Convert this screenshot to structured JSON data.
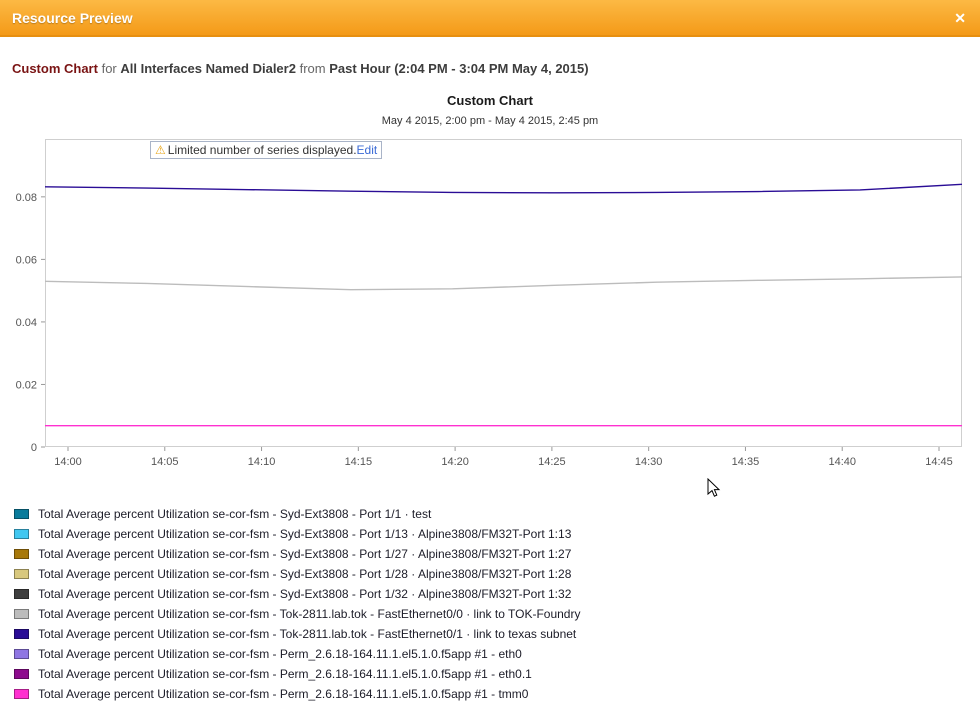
{
  "window": {
    "title": "Resource Preview",
    "close_label": "✕",
    "accent_color": "#f49a18"
  },
  "description": {
    "chart_name": "Custom Chart",
    "for_word": "for",
    "scope": "All Interfaces Named Dialer2",
    "from_word": "from",
    "range": "Past Hour (2:04 PM - 3:04 PM May 4, 2015)"
  },
  "chart_data": {
    "type": "line",
    "title": "Custom Chart",
    "subtitle": "May 4 2015, 2:00 pm - May 4 2015, 2:45 pm",
    "warning": {
      "icon": "⚠",
      "text": "Limited number of series displayed.",
      "link": "Edit"
    },
    "x_ticks": [
      "14:00",
      "14:05",
      "14:10",
      "14:15",
      "14:20",
      "14:25",
      "14:30",
      "14:35",
      "14:40",
      "14:45"
    ],
    "y_ticks": [
      "0",
      "0.02",
      "0.04",
      "0.06",
      "0.08"
    ],
    "ylim": [
      0,
      0.0985
    ],
    "grid": false,
    "legend_position": "bottom",
    "series": [
      {
        "name": "Total Average percent Utilization se-cor-fsm - Tok-2811.lab.tok - FastEthernet0/1 · link to texas subnet",
        "color": "#2a0d96",
        "values": [
          0.0832,
          0.0828,
          0.0823,
          0.0818,
          0.0814,
          0.0813,
          0.0814,
          0.0817,
          0.0822,
          0.084
        ]
      },
      {
        "name": "Total Average percent Utilization se-cor-fsm - Tok-2811.lab.tok - FastEthernet0/0 · link to TOK-Foundry",
        "color": "#bcbcbc",
        "values": [
          0.053,
          0.0523,
          0.0513,
          0.0503,
          0.0506,
          0.0517,
          0.0527,
          0.0533,
          0.0538,
          0.0544
        ]
      },
      {
        "name": "Total Average percent Utilization se-cor-fsm - Perm_2.6.18-164.11.1.el5.1.0.f5app #1 - tmm0",
        "color": "#ff30d0",
        "values": [
          0.0068,
          0.0068,
          0.0068,
          0.0068,
          0.0068,
          0.0068,
          0.0068,
          0.0068,
          0.0068,
          0.0068
        ]
      }
    ],
    "legend": [
      {
        "color": "#0a7c9c",
        "label": "Total Average percent Utilization se-cor-fsm - Syd-Ext3808 - Port 1/1 · test"
      },
      {
        "color": "#41c7f0",
        "label": "Total Average percent Utilization se-cor-fsm - Syd-Ext3808 - Port 1/13 · Alpine3808/FM32T-Port 1:13"
      },
      {
        "color": "#a8790b",
        "label": "Total Average percent Utilization se-cor-fsm - Syd-Ext3808 - Port 1/27 · Alpine3808/FM32T-Port 1:27"
      },
      {
        "color": "#d8c87e",
        "label": "Total Average percent Utilization se-cor-fsm - Syd-Ext3808 - Port 1/28 · Alpine3808/FM32T-Port 1:28"
      },
      {
        "color": "#3f3f3f",
        "label": "Total Average percent Utilization se-cor-fsm - Syd-Ext3808 - Port 1/32 · Alpine3808/FM32T-Port 1:32"
      },
      {
        "color": "#bcbcbc",
        "label": "Total Average percent Utilization se-cor-fsm - Tok-2811.lab.tok - FastEthernet0/0 · link to TOK-Foundry"
      },
      {
        "color": "#2a0d96",
        "label": "Total Average percent Utilization se-cor-fsm - Tok-2811.lab.tok - FastEthernet0/1 · link to texas subnet"
      },
      {
        "color": "#8f76e3",
        "label": "Total Average percent Utilization se-cor-fsm - Perm_2.6.18-164.11.1.el5.1.0.f5app #1 - eth0"
      },
      {
        "color": "#8e0b8e",
        "label": "Total Average percent Utilization se-cor-fsm - Perm_2.6.18-164.11.1.el5.1.0.f5app #1 - eth0.1"
      },
      {
        "color": "#ff30d0",
        "label": "Total Average percent Utilization se-cor-fsm - Perm_2.6.18-164.11.1.el5.1.0.f5app #1 - tmm0"
      }
    ]
  }
}
